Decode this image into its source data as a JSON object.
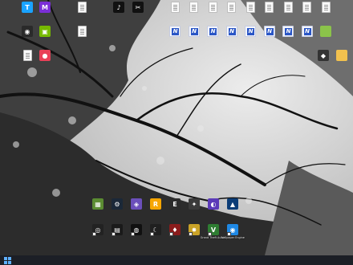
{
  "desktop": {
    "icons_left": [
      {
        "name": "tencent-app-icon",
        "label": "",
        "color": "#1aa3ff",
        "glyph": "T"
      },
      {
        "name": "media-player-icon",
        "label": "",
        "color": "#7b2fd6",
        "glyph": "M"
      },
      {
        "name": "document-icon",
        "label": "",
        "type": "doc"
      },
      {
        "name": "tiktok-icon",
        "label": "",
        "color": "#111111",
        "glyph": "♪"
      },
      {
        "name": "capcut-icon",
        "label": "",
        "color": "#111111",
        "glyph": "✂"
      },
      {
        "name": "app-icon-1",
        "label": "",
        "color": "#2a2a2a",
        "glyph": "◉"
      },
      {
        "name": "nvidia-icon",
        "label": "",
        "color": "#76b900",
        "glyph": "▣"
      },
      {
        "name": "document-icon-2",
        "label": "",
        "type": "doc"
      },
      {
        "name": "document-icon-3",
        "label": "",
        "type": "doc"
      },
      {
        "name": "colorful-app-icon",
        "label": "",
        "color": "#e94057",
        "glyph": "●"
      }
    ],
    "icons_top_right_row1": [
      {
        "name": "folder-icon",
        "label": "",
        "type": "doc"
      },
      {
        "name": "image-file-icon-1",
        "label": "",
        "type": "doc"
      },
      {
        "name": "image-file-icon-2",
        "label": "",
        "type": "doc"
      },
      {
        "name": "image-file-icon-3",
        "label": "",
        "type": "doc"
      },
      {
        "name": "image-file-icon-4",
        "label": "",
        "type": "doc"
      },
      {
        "name": "image-file-icon-5",
        "label": "",
        "type": "doc"
      },
      {
        "name": "blank-file-icon-1",
        "label": "",
        "type": "doc"
      },
      {
        "name": "blank-file-icon-2",
        "label": "",
        "type": "doc"
      },
      {
        "name": "blank-file-icon-3",
        "label": "",
        "type": "doc"
      }
    ],
    "icons_top_right_row2": [
      {
        "name": "word-file-icon-1",
        "label": "",
        "glyph": "N"
      },
      {
        "name": "word-file-icon-2",
        "label": "",
        "glyph": "N"
      },
      {
        "name": "word-file-icon-3",
        "label": "",
        "glyph": "N"
      },
      {
        "name": "word-file-icon-4",
        "label": "",
        "glyph": "N"
      },
      {
        "name": "word-file-icon-5",
        "label": "",
        "glyph": "N"
      },
      {
        "name": "word-file-icon-6",
        "label": "",
        "glyph": "N"
      },
      {
        "name": "word-file-icon-7",
        "label": "",
        "glyph": "N"
      },
      {
        "name": "word-file-icon-8",
        "label": "",
        "glyph": "N"
      },
      {
        "name": "green-app-icon",
        "label": "",
        "color": "#8bc34a",
        "glyph": ""
      }
    ],
    "icons_right_col": [
      {
        "name": "game-app-icon",
        "label": "",
        "color": "#333333",
        "glyph": "◆"
      },
      {
        "name": "folder-icon-2",
        "label": "",
        "color": "#f2c14e",
        "glyph": ""
      }
    ],
    "icons_bottom_row1": [
      {
        "name": "minecraft-icon",
        "label": "",
        "color": "#5b8c32",
        "glyph": "▦"
      },
      {
        "name": "steam-icon",
        "label": "",
        "color": "#1b2838",
        "glyph": "⚙"
      },
      {
        "name": "game-launcher-icon",
        "label": "",
        "color": "#6b4fbb",
        "glyph": "◈"
      },
      {
        "name": "rockstar-icon",
        "label": "",
        "color": "#f7a600",
        "glyph": "R"
      },
      {
        "name": "epic-games-icon",
        "label": "",
        "color": "#2b2b2b",
        "glyph": "E"
      },
      {
        "name": "app-icon-2",
        "label": "",
        "color": "#3a3a3a",
        "glyph": "✦"
      },
      {
        "name": "wallpaper-engine-icon-1",
        "label": "",
        "color": "#5b3ab8",
        "glyph": "◐"
      },
      {
        "name": "app-icon-3",
        "label": "",
        "color": "#0c3d77",
        "glyph": "▲"
      }
    ],
    "icons_bottom_row2": [
      {
        "name": "shortcut-icon-1",
        "label": "",
        "color": "#222222",
        "glyph": "◎"
      },
      {
        "name": "shortcut-icon-2",
        "label": "",
        "color": "#1a1a1a",
        "glyph": "▤"
      },
      {
        "name": "shortcut-icon-3",
        "label": "",
        "color": "#101010",
        "glyph": "◍"
      },
      {
        "name": "shortcut-icon-4",
        "label": "",
        "color": "#202020",
        "glyph": "☾"
      },
      {
        "name": "shortcut-icon-5",
        "label": "",
        "color": "#8a1c1c",
        "glyph": "♦"
      },
      {
        "name": "shortcut-icon-6",
        "label": "",
        "color": "#c9a227",
        "glyph": "✸"
      },
      {
        "name": "grand-theft-auto-icon",
        "label": "Grand Theft Auto V",
        "color": "#2e7d32",
        "glyph": "V"
      },
      {
        "name": "wallpaper-engine-icon-2",
        "label": "Wallpaper Engine",
        "color": "#1e88e5",
        "glyph": "◉"
      }
    ]
  },
  "taskbar": {
    "start_label": ""
  }
}
